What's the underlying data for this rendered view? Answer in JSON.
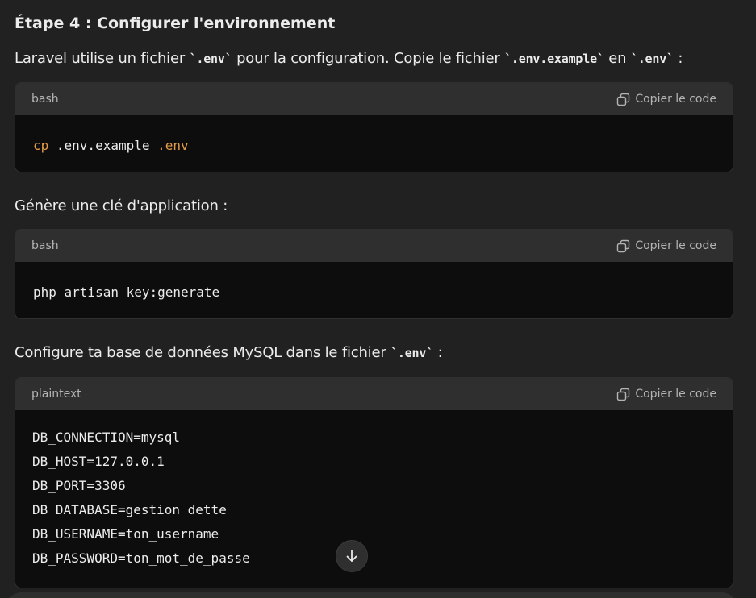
{
  "heading": "Étape 4 : Configurer l'environnement",
  "para1": {
    "t1": "Laravel utilise un fichier ",
    "c1": "`.env`",
    "t2": " pour la configuration. Copie le fichier ",
    "c2": "`.env.example`",
    "t3": " en ",
    "c3": "`.env`",
    "t4": " :"
  },
  "block1": {
    "lang": "bash",
    "copy_label": "Copier le code",
    "cmd": "cp",
    "arg1": " .env.example ",
    "arg2": ".env"
  },
  "para2": "Génère une clé d'application :",
  "block2": {
    "lang": "bash",
    "copy_label": "Copier le code",
    "line": "php artisan key:generate"
  },
  "para3": {
    "t1": "Configure ta base de données MySQL dans le fichier ",
    "c1": "`.env`",
    "t2": " :"
  },
  "block3": {
    "lang": "plaintext",
    "copy_label": "Copier le code",
    "lines": [
      "DB_CONNECTION=mysql",
      "DB_HOST=127.0.0.1",
      "DB_PORT=3306",
      "DB_DATABASE=gestion_dette",
      "DB_USERNAME=ton_username",
      "DB_PASSWORD=ton_mot_de_passe"
    ]
  },
  "icons": {
    "copy": "copy-icon",
    "scroll_down": "arrow-down-icon"
  },
  "colors": {
    "background": "#212121",
    "code_background": "#0d0d0d",
    "code_header": "#2f2f2f",
    "keyword": "#e49b48"
  }
}
